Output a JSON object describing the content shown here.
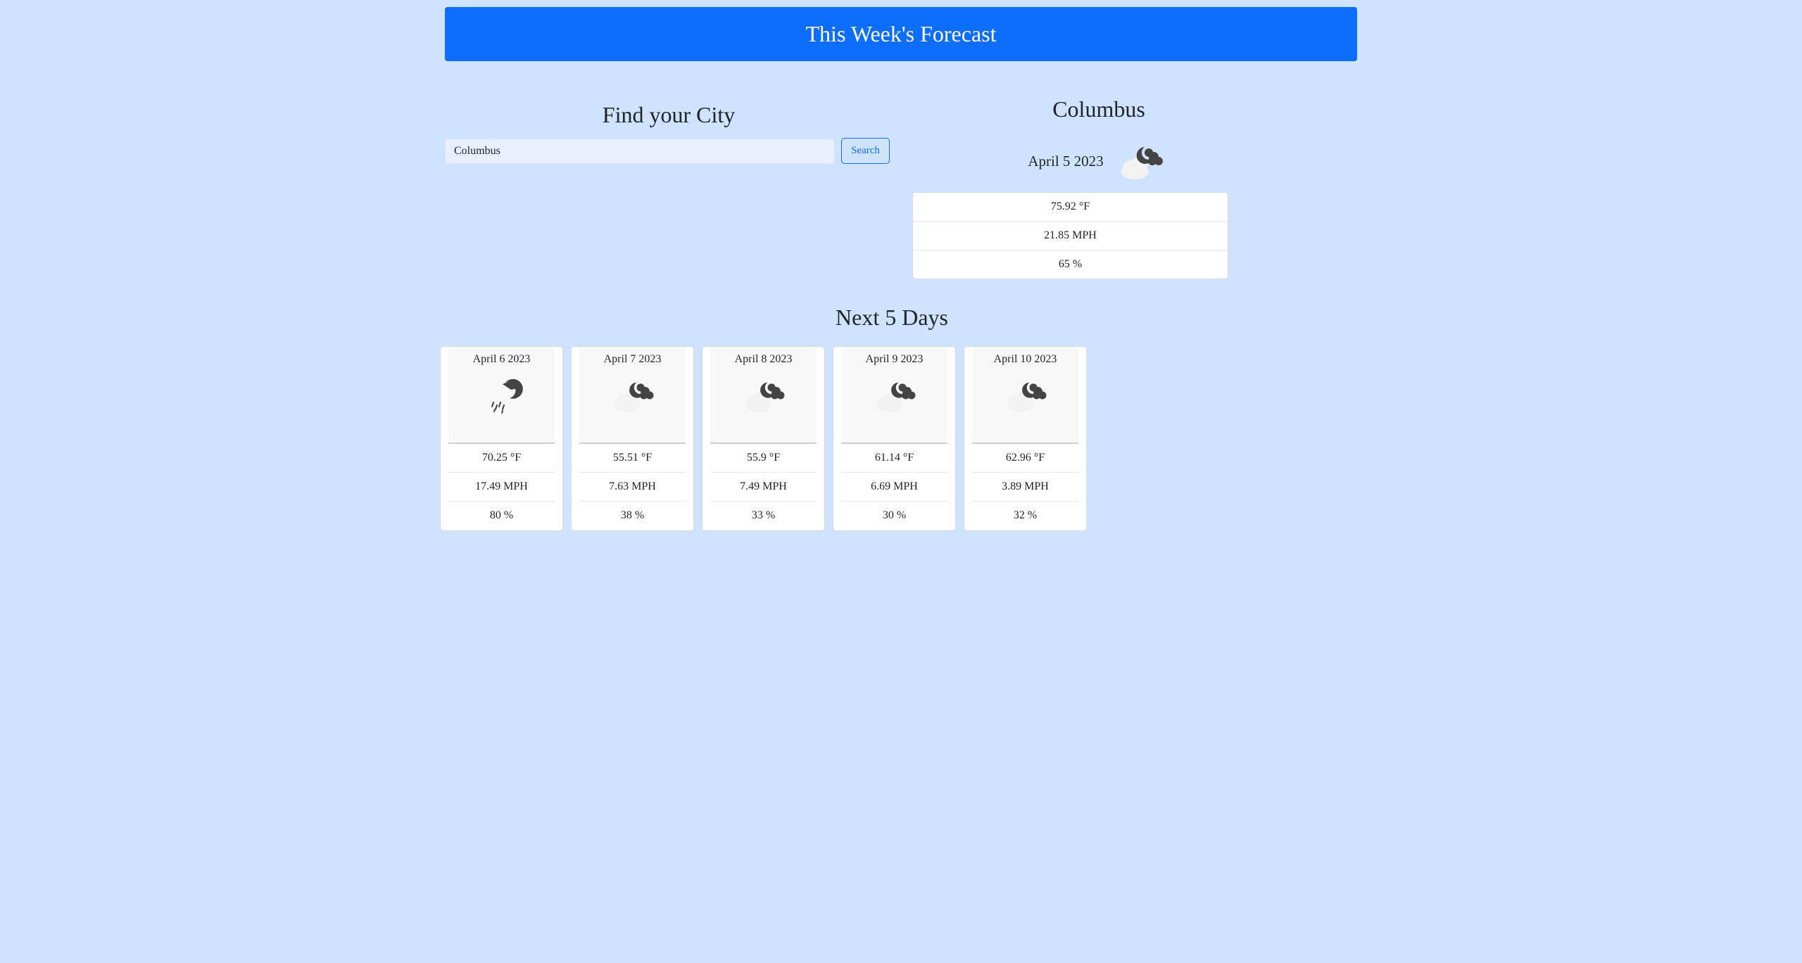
{
  "header": {
    "title": "This Week's Forecast"
  },
  "search": {
    "heading": "Find your City",
    "value": "Columbus",
    "button_label": "Search"
  },
  "current": {
    "city": "Columbus",
    "date": "April 5 2023",
    "icon": "partly-cloudy-night-icon",
    "temp": "75.92 °F",
    "wind": "21.85 MPH",
    "humidity": "65 %"
  },
  "forecast": {
    "heading": "Next 5 Days",
    "days": [
      {
        "date": "April 6 2023",
        "icon": "night-rain-icon",
        "temp": "70.25 °F",
        "wind": "17.49 MPH",
        "humidity": "80 %"
      },
      {
        "date": "April 7 2023",
        "icon": "partly-cloudy-night-icon",
        "temp": "55.51 °F",
        "wind": "7.63 MPH",
        "humidity": "38 %"
      },
      {
        "date": "April 8 2023",
        "icon": "partly-cloudy-night-icon",
        "temp": "55.9 °F",
        "wind": "7.49 MPH",
        "humidity": "33 %"
      },
      {
        "date": "April 9 2023",
        "icon": "partly-cloudy-night-icon",
        "temp": "61.14 °F",
        "wind": "6.69 MPH",
        "humidity": "30 %"
      },
      {
        "date": "April 10 2023",
        "icon": "partly-cloudy-night-icon",
        "temp": "62.96 °F",
        "wind": "3.89 MPH",
        "humidity": "32 %"
      }
    ]
  },
  "colors": {
    "page_background": "#cfe2ff",
    "header_background": "#0d6efd",
    "accent": "#0d6efd"
  }
}
